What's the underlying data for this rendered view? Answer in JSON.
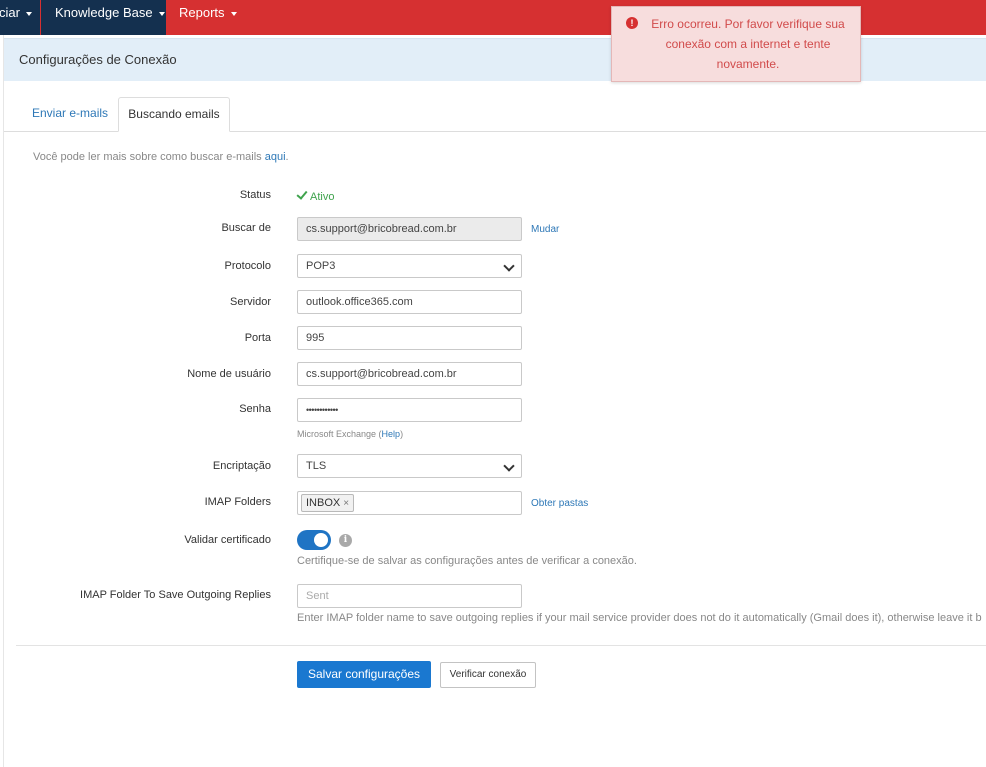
{
  "nav": {
    "items": [
      {
        "label": "ciar"
      },
      {
        "label": "Knowledge Base"
      },
      {
        "label": "Reports"
      }
    ]
  },
  "alert": {
    "message": "Erro ocorreu. Por favor verifique sua conexão com a internet e tente novamente."
  },
  "panel": {
    "title": "Configurações de Conexão"
  },
  "tabs": [
    {
      "label": "Enviar e-mails",
      "active": false
    },
    {
      "label": "Buscando emails",
      "active": true
    }
  ],
  "intro": {
    "text": "Você pode ler mais sobre como buscar e-mails ",
    "link": "aqui",
    "suffix": "."
  },
  "form": {
    "status": {
      "label": "Status",
      "value": "Ativo"
    },
    "buscar_de": {
      "label": "Buscar de",
      "value": "cs.support@bricobread.com.br",
      "action": "Mudar"
    },
    "protocolo": {
      "label": "Protocolo",
      "value": "POP3"
    },
    "servidor": {
      "label": "Servidor",
      "value": "outlook.office365.com"
    },
    "porta": {
      "label": "Porta",
      "value": "995"
    },
    "usuario": {
      "label": "Nome de usuário",
      "value": "cs.support@bricobread.com.br"
    },
    "senha": {
      "label": "Senha",
      "value": "••••••••••••",
      "help_prefix": "Microsoft Exchange (",
      "help_link": "Help",
      "help_suffix": ")"
    },
    "encriptacao": {
      "label": "Encriptação",
      "value": "TLS"
    },
    "imap_folders": {
      "label": "IMAP Folders",
      "tag": "INBOX",
      "tag_remove": "×",
      "action": "Obter pastas"
    },
    "validar": {
      "label": "Validar certificado",
      "enabled": true,
      "info_icon": "info-icon",
      "hint": "Certifique-se de salvar as configurações antes de verificar a conexão."
    },
    "outgoing": {
      "label": "IMAP Folder To Save Outgoing Replies",
      "placeholder": "Sent",
      "hint": "Enter IMAP folder name to save outgoing replies if your mail service provider does not do it automatically (Gmail does it), otherwise leave it b"
    }
  },
  "buttons": {
    "save": "Salvar configurações",
    "verify": "Verificar conexão"
  },
  "colors": {
    "nav_red": "#d63031",
    "nav_dark": "#14304f",
    "primary": "#1a78d0",
    "success": "#3fa34d"
  }
}
